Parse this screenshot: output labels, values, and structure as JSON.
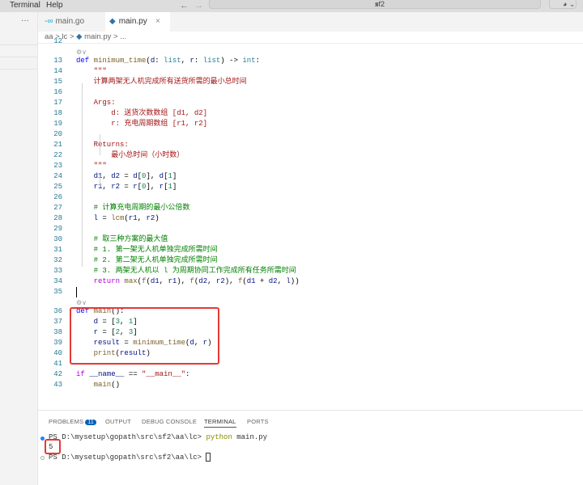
{
  "menu": {
    "items": [
      "Terminal",
      "Help"
    ],
    "search": "sf2",
    "back": "←",
    "forward": "→"
  },
  "tabs": [
    {
      "label": "main.go",
      "icon": "go-icon"
    },
    {
      "label": "main.py",
      "icon": "python-icon",
      "close": "×"
    }
  ],
  "sidebar": {
    "more": "···"
  },
  "breadcrumb": {
    "parts": [
      "aa",
      ">",
      "lc",
      ">",
      "main.py",
      ">",
      "..."
    ]
  },
  "editor": {
    "lines": [
      {
        "n": "12",
        "t": []
      },
      {
        "lens": true
      },
      {
        "n": "13",
        "t": [
          [
            "def ",
            "kw"
          ],
          [
            "minimum_time",
            "fn"
          ],
          [
            "(",
            "pl"
          ],
          [
            "d",
            "pa"
          ],
          [
            ": ",
            "pl"
          ],
          [
            "list",
            "ty"
          ],
          [
            ", ",
            "pl"
          ],
          [
            "r",
            "pa"
          ],
          [
            ": ",
            "pl"
          ],
          [
            "list",
            "ty"
          ],
          [
            ") -> ",
            "pl"
          ],
          [
            "int",
            "ty"
          ],
          [
            ":",
            "pl"
          ]
        ]
      },
      {
        "n": "14",
        "t": [
          [
            "    \"\"\"",
            "st"
          ]
        ]
      },
      {
        "n": "15",
        "t": [
          [
            "    计算两架无人机完成所有送货所需的最小总时间",
            "st"
          ]
        ]
      },
      {
        "n": "16",
        "t": []
      },
      {
        "n": "17",
        "t": [
          [
            "    Args:",
            "st"
          ]
        ]
      },
      {
        "n": "18",
        "t": [
          [
            "        d: 送货次数数组 [d1, d2]",
            "st"
          ]
        ]
      },
      {
        "n": "19",
        "t": [
          [
            "        r: 充电周期数组 [r1, r2]",
            "st"
          ]
        ]
      },
      {
        "n": "20",
        "t": []
      },
      {
        "n": "21",
        "t": [
          [
            "    Returns:",
            "st"
          ]
        ]
      },
      {
        "n": "22",
        "t": [
          [
            "        最小总时间（小时数）",
            "st"
          ]
        ]
      },
      {
        "n": "23",
        "t": [
          [
            "    \"\"\"",
            "st"
          ]
        ]
      },
      {
        "n": "24",
        "t": [
          [
            "    d1",
            "pa"
          ],
          [
            ", ",
            "pl"
          ],
          [
            "d2",
            "pa"
          ],
          [
            " = ",
            "pl"
          ],
          [
            "d",
            "pa"
          ],
          [
            "[",
            "pl"
          ],
          [
            "0",
            "nu"
          ],
          [
            "], ",
            "pl"
          ],
          [
            "d",
            "pa"
          ],
          [
            "[",
            "pl"
          ],
          [
            "1",
            "nu"
          ],
          [
            "]",
            "pl"
          ]
        ]
      },
      {
        "n": "25",
        "t": [
          [
            "    r1",
            "pa"
          ],
          [
            ", ",
            "pl"
          ],
          [
            "r2",
            "pa"
          ],
          [
            " = ",
            "pl"
          ],
          [
            "r",
            "pa"
          ],
          [
            "[",
            "pl"
          ],
          [
            "0",
            "nu"
          ],
          [
            "], ",
            "pl"
          ],
          [
            "r",
            "pa"
          ],
          [
            "[",
            "pl"
          ],
          [
            "1",
            "nu"
          ],
          [
            "]",
            "pl"
          ]
        ]
      },
      {
        "n": "26",
        "t": []
      },
      {
        "n": "27",
        "t": [
          [
            "    # 计算充电周期的最小公倍数",
            "cm"
          ]
        ]
      },
      {
        "n": "28",
        "t": [
          [
            "    l",
            "pa"
          ],
          [
            " = ",
            "pl"
          ],
          [
            "lcm",
            "fn"
          ],
          [
            "(",
            "pl"
          ],
          [
            "r1",
            "pa"
          ],
          [
            ", ",
            "pl"
          ],
          [
            "r2",
            "pa"
          ],
          [
            ")",
            "pl"
          ]
        ]
      },
      {
        "n": "29",
        "t": []
      },
      {
        "n": "30",
        "t": [
          [
            "    # 取三种方案的最大值",
            "cm"
          ]
        ]
      },
      {
        "n": "31",
        "t": [
          [
            "    # 1. 第一架无人机单独完成所需时间",
            "cm"
          ]
        ]
      },
      {
        "n": "32",
        "t": [
          [
            "    # 2. 第二架无人机单独完成所需时间",
            "cm"
          ]
        ]
      },
      {
        "n": "33",
        "t": [
          [
            "    # 3. 两架无人机以 l 为周期协同工作完成所有任务所需时间",
            "cm"
          ]
        ]
      },
      {
        "n": "34",
        "t": [
          [
            "    return ",
            "ct"
          ],
          [
            "max",
            "fn"
          ],
          [
            "(",
            "pl"
          ],
          [
            "f",
            "fn"
          ],
          [
            "(",
            "pl"
          ],
          [
            "d1",
            "pa"
          ],
          [
            ", ",
            "pl"
          ],
          [
            "r1",
            "pa"
          ],
          [
            "), ",
            "pl"
          ],
          [
            "f",
            "fn"
          ],
          [
            "(",
            "pl"
          ],
          [
            "d2",
            "pa"
          ],
          [
            ", ",
            "pl"
          ],
          [
            "r2",
            "pa"
          ],
          [
            "), ",
            "pl"
          ],
          [
            "f",
            "fn"
          ],
          [
            "(",
            "pl"
          ],
          [
            "d1",
            "pa"
          ],
          [
            " + ",
            "pl"
          ],
          [
            "d2",
            "pa"
          ],
          [
            ", ",
            "pl"
          ],
          [
            "l",
            "pa"
          ],
          [
            "))",
            "pl"
          ]
        ]
      },
      {
        "n": "35",
        "t": []
      },
      {
        "lens": true
      },
      {
        "n": "36",
        "t": [
          [
            "def ",
            "kw"
          ],
          [
            "main",
            "fn"
          ],
          [
            "():",
            "pl"
          ]
        ]
      },
      {
        "n": "37",
        "t": [
          [
            "    d",
            "pa"
          ],
          [
            " = [",
            "pl"
          ],
          [
            "3",
            "nu"
          ],
          [
            ", ",
            "pl"
          ],
          [
            "1",
            "nu"
          ],
          [
            "]",
            "pl"
          ]
        ]
      },
      {
        "n": "38",
        "t": [
          [
            "    r",
            "pa"
          ],
          [
            " = [",
            "pl"
          ],
          [
            "2",
            "nu"
          ],
          [
            ", ",
            "pl"
          ],
          [
            "3",
            "nu"
          ],
          [
            "]",
            "pl"
          ]
        ]
      },
      {
        "n": "39",
        "t": [
          [
            "    result",
            "pa"
          ],
          [
            " = ",
            "pl"
          ],
          [
            "minimum_time",
            "fn"
          ],
          [
            "(",
            "pl"
          ],
          [
            "d",
            "pa"
          ],
          [
            ", ",
            "pl"
          ],
          [
            "r",
            "pa"
          ],
          [
            ")",
            "pl"
          ]
        ]
      },
      {
        "n": "40",
        "t": [
          [
            "    print",
            "fn"
          ],
          [
            "(",
            "pl"
          ],
          [
            "result",
            "pa"
          ],
          [
            ")",
            "pl"
          ]
        ]
      },
      {
        "n": "41",
        "t": []
      },
      {
        "n": "42",
        "t": [
          [
            "if ",
            "ct"
          ],
          [
            "__name__",
            "pa"
          ],
          [
            " == ",
            "pl"
          ],
          [
            "\"__main__\"",
            "st"
          ],
          [
            ":",
            "pl"
          ]
        ]
      },
      {
        "n": "43",
        "t": [
          [
            "    main",
            "fn"
          ],
          [
            "()",
            "pl"
          ]
        ]
      }
    ],
    "lens_icon": "⚙∨"
  },
  "panel": {
    "tabs": [
      "PROBLEMS",
      "OUTPUT",
      "DEBUG CONSOLE",
      "TERMINAL",
      "PORTS"
    ],
    "problems_count": "11",
    "terminal": {
      "prompt": "PS D:\\mysetup\\gopath\\src\\sf2\\aa\\lc> ",
      "cmd": "python",
      "args": " main.py",
      "output": "5",
      "prompt2": "PS D:\\mysetup\\gopath\\src\\sf2\\aa\\lc> "
    }
  },
  "colors": {
    "highlight": "#e53935",
    "accent": "#005fb8"
  }
}
